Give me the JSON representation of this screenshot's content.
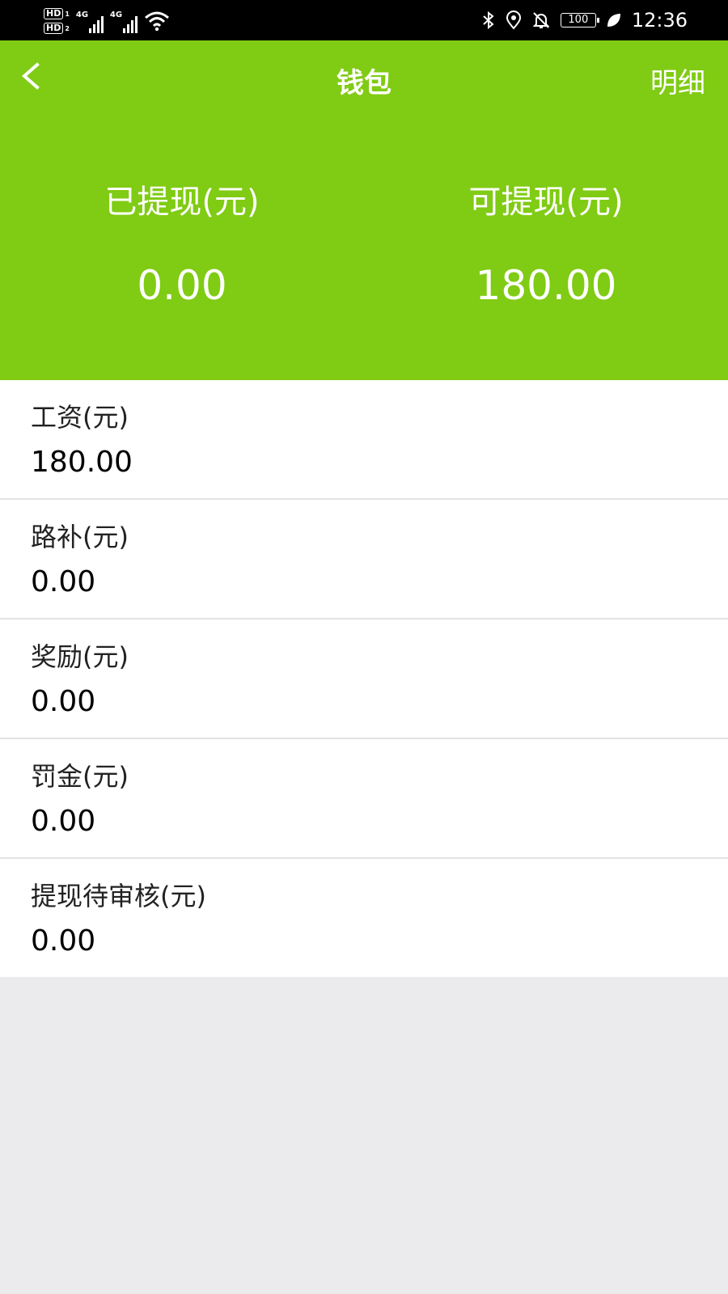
{
  "status_bar": {
    "sim1": "HD",
    "sim1_num": "1",
    "sim2": "HD",
    "sim2_num": "2",
    "net1": "4G",
    "net2": "4G",
    "battery": "100",
    "time": "12:36",
    "icons": [
      "bluetooth-icon",
      "location-icon",
      "bell-off-icon",
      "battery-icon",
      "leaf-icon"
    ]
  },
  "header": {
    "title": "钱包",
    "detail_label": "明细",
    "back_icon": "chevron-left-icon",
    "background_color": "#80cb14"
  },
  "summary": {
    "withdrawn_label": "已提现(元)",
    "withdrawn_value": "0.00",
    "available_label": "可提现(元)",
    "available_value": "180.00"
  },
  "items": [
    {
      "label": "工资(元)",
      "value": "180.00"
    },
    {
      "label": "路补(元)",
      "value": "0.00"
    },
    {
      "label": "奖励(元)",
      "value": "0.00"
    },
    {
      "label": "罚金(元)",
      "value": "0.00"
    },
    {
      "label": "提现待审核(元)",
      "value": "0.00"
    }
  ]
}
